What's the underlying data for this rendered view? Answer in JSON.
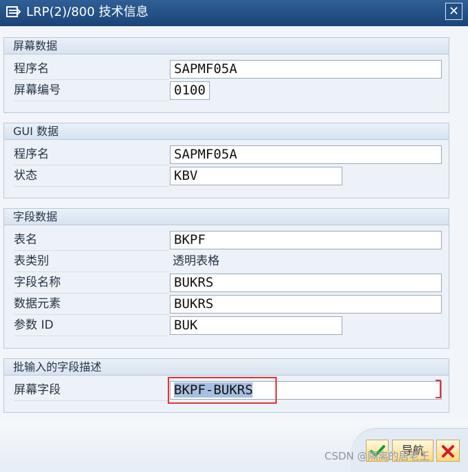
{
  "window": {
    "title": "LRP(2)/800 技术信息",
    "close_glyph": "✕"
  },
  "groups": {
    "screen_data": {
      "header": "屏幕数据",
      "program_label": "程序名",
      "program_value": "SAPMF05A",
      "screen_no_label": "屏幕编号",
      "screen_no_value": "0100"
    },
    "gui_data": {
      "header": "GUI 数据",
      "program_label": "程序名",
      "program_value": "SAPMF05A",
      "status_label": "状态",
      "status_value": "KBV"
    },
    "field_data": {
      "header": "字段数据",
      "table_label": "表名",
      "table_value": "BKPF",
      "table_category_label": "表类别",
      "table_category_value": "透明表格",
      "field_name_label": "字段名称",
      "field_name_value": "BUKRS",
      "data_element_label": "数据元素",
      "data_element_value": "BUKRS",
      "parameter_id_label": "参数 ID",
      "parameter_id_value": "BUK"
    },
    "batch_input": {
      "header": "批输入的字段描述",
      "screen_field_label": "屏幕字段",
      "screen_field_value": "BKPF-BUKRS"
    }
  },
  "buttons": {
    "ok_icon": "green-check-icon",
    "navigation_label": "导航",
    "cancel_icon": "red-x-icon"
  },
  "watermark": {
    "text": "CSDN @隔离的居老王"
  },
  "colors": {
    "title_blue": "#1b4478",
    "group_border": "#b9c8d8",
    "highlight_red": "#e33232",
    "button_yellow": "#ffd77b"
  }
}
